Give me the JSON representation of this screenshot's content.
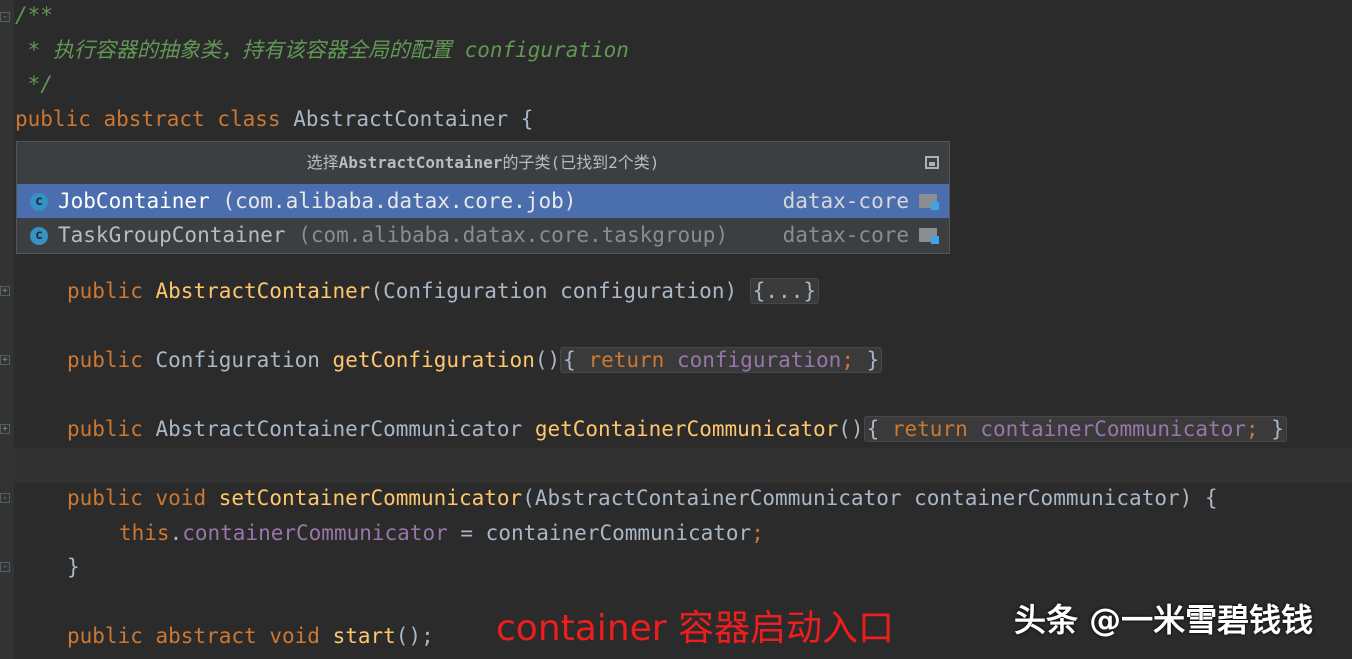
{
  "editor": {
    "comment_open": "/**",
    "comment_desc": " * 执行容器的抽象类，持有该容器全局的配置 configuration",
    "comment_close": " */",
    "class_kw_public": "public",
    "class_kw_abstract": "abstract",
    "class_kw_class": "class",
    "class_name": "AbstractContainer",
    "class_brace": "{",
    "ctor": {
      "kw": "public",
      "name": "AbstractContainer",
      "params": "(Configuration configuration)",
      "folded": "{...}"
    },
    "get_config": {
      "kw": "public",
      "type": "Configuration",
      "name": "getConfiguration",
      "parens": "()",
      "open": "{",
      "ret": "return",
      "field": "configuration",
      "semi": ";",
      "close": "}"
    },
    "get_comm": {
      "kw": "public",
      "type": "AbstractContainerCommunicator",
      "name": "getContainerCommunicator",
      "parens": "()",
      "open": "{",
      "ret": "return",
      "field": "containerCommunicator",
      "semi": ";",
      "close": "}"
    },
    "set_comm": {
      "kw_public": "public",
      "kw_void": "void",
      "name": "setContainerCommunicator",
      "params": "(AbstractContainerCommunicator containerCommunicator) {",
      "this_kw": "this",
      "dot": ".",
      "field": "containerCommunicator",
      "assign": " = containerCommunicator",
      "semi": ";",
      "close": "}"
    },
    "start": {
      "kw_public": "public",
      "kw_abstract": "abstract",
      "kw_void": "void",
      "name": "start",
      "rest": "();"
    }
  },
  "popup": {
    "title_prefix": "选择",
    "title_class": "AbstractContainer",
    "title_suffix": "的子类(已找到2个类)",
    "items": [
      {
        "icon": "class-icon",
        "icon_letter": "c",
        "name": "JobContainer",
        "package": " (com.alibaba.datax.core.job)",
        "module": "datax-core",
        "selected": true
      },
      {
        "icon": "class-icon",
        "icon_letter": "c",
        "name": "TaskGroupContainer",
        "package": " (com.alibaba.datax.core.taskgroup)",
        "module": "datax-core",
        "selected": false
      }
    ]
  },
  "annotation": "container 容器启动入口",
  "watermark": "头条 @一米雪碧钱钱"
}
